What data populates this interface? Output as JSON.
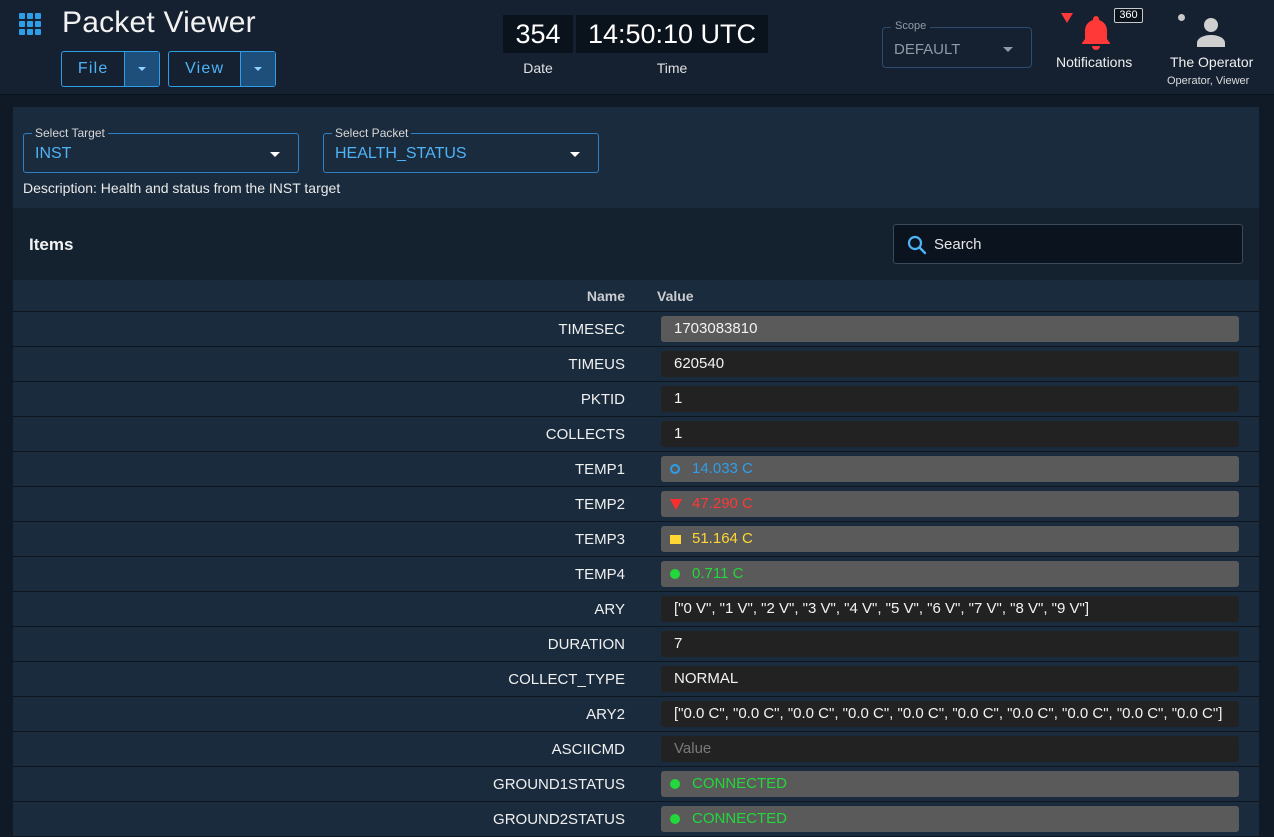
{
  "app": {
    "title": "Packet Viewer",
    "menus": [
      {
        "label": "File"
      },
      {
        "label": "View"
      }
    ]
  },
  "clock": {
    "date": "354",
    "time": "14:50:10 UTC",
    "date_caption": "Date",
    "time_caption": "Time"
  },
  "scope": {
    "label": "Scope",
    "value": "DEFAULT"
  },
  "notifications": {
    "label": "Notifications",
    "count": "360"
  },
  "user": {
    "name": "The Operator",
    "roles": "Operator, Viewer"
  },
  "selectors": {
    "target": {
      "label": "Select Target",
      "value": "INST"
    },
    "packet": {
      "label": "Select Packet",
      "value": "HEALTH_STATUS"
    },
    "description": "Description: Health and status from the INST target"
  },
  "items": {
    "title": "Items",
    "search_placeholder": "Search",
    "columns": {
      "name": "Name",
      "value": "Value"
    },
    "rows": [
      {
        "name": "TIMESEC",
        "value": "1703083810",
        "bg": "stale",
        "indicator": "",
        "color": ""
      },
      {
        "name": "TIMEUS",
        "value": "620540",
        "bg": "normal",
        "indicator": "",
        "color": ""
      },
      {
        "name": "PKTID",
        "value": "1",
        "bg": "normal",
        "indicator": "",
        "color": ""
      },
      {
        "name": "COLLECTS",
        "value": "1",
        "bg": "normal",
        "indicator": "",
        "color": ""
      },
      {
        "name": "TEMP1",
        "value": "14.033 C",
        "bg": "stale",
        "indicator": "circle-outline",
        "color": "#2f9ee8"
      },
      {
        "name": "TEMP2",
        "value": "47.290 C",
        "bg": "stale",
        "indicator": "tri",
        "color": "#ff3838"
      },
      {
        "name": "TEMP3",
        "value": "51.164 C",
        "bg": "stale",
        "indicator": "square",
        "color": "#ffd633"
      },
      {
        "name": "TEMP4",
        "value": "0.711 C",
        "bg": "stale",
        "indicator": "dot",
        "color": "#22d83a"
      },
      {
        "name": "ARY",
        "value": "[\"0 V\", \"1 V\", \"2 V\", \"3 V\", \"4 V\", \"5 V\", \"6 V\", \"7 V\", \"8 V\", \"9 V\"]",
        "bg": "normal",
        "indicator": "",
        "color": ""
      },
      {
        "name": "DURATION",
        "value": "7",
        "bg": "normal",
        "indicator": "",
        "color": ""
      },
      {
        "name": "COLLECT_TYPE",
        "value": "NORMAL",
        "bg": "normal",
        "indicator": "",
        "color": ""
      },
      {
        "name": "ARY2",
        "value": "[\"0.0 C\", \"0.0 C\", \"0.0 C\", \"0.0 C\", \"0.0 C\", \"0.0 C\", \"0.0 C\", \"0.0 C\", \"0.0 C\", \"0.0 C\"]",
        "bg": "normal",
        "indicator": "",
        "color": ""
      },
      {
        "name": "ASCIICMD",
        "value": "Value",
        "bg": "placeholder",
        "indicator": "",
        "color": ""
      },
      {
        "name": "GROUND1STATUS",
        "value": "CONNECTED",
        "bg": "stale",
        "indicator": "dot",
        "color": "#22d83a"
      },
      {
        "name": "GROUND2STATUS",
        "value": "CONNECTED",
        "bg": "stale",
        "indicator": "dot",
        "color": "#22d83a"
      }
    ]
  },
  "icons": {
    "apps": "grid-icon",
    "bell": "bell-icon",
    "user": "person-icon",
    "search": "search-icon"
  },
  "colors": {
    "accent": "#2f9ee8",
    "alert": "#ff3838",
    "caution": "#ffd633",
    "ok": "#22d83a"
  }
}
